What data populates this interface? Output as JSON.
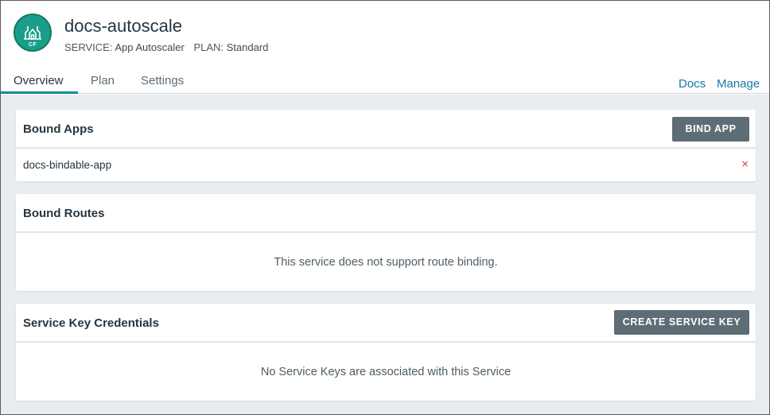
{
  "header": {
    "title": "docs-autoscale",
    "logo_text": "CF",
    "service_label": "SERVICE:",
    "service_value": "App Autoscaler",
    "plan_label": "PLAN:",
    "plan_value": "Standard"
  },
  "tabs": [
    {
      "label": "Overview",
      "active": true
    },
    {
      "label": "Plan",
      "active": false
    },
    {
      "label": "Settings",
      "active": false
    }
  ],
  "links": {
    "docs": "Docs",
    "manage": "Manage"
  },
  "bound_apps": {
    "title": "Bound Apps",
    "button": "BIND APP",
    "items": [
      {
        "name": "docs-bindable-app",
        "remove_icon": "×"
      }
    ]
  },
  "bound_routes": {
    "title": "Bound Routes",
    "message": "This service does not support route binding."
  },
  "service_keys": {
    "title": "Service Key Credentials",
    "button": "CREATE SERVICE KEY",
    "message": "No Service Keys are associated with this Service"
  },
  "colors": {
    "accent": "#1a8a96",
    "link": "#1a77a8",
    "button": "#5e6c75",
    "remove": "#d9383a",
    "logo": "#1a9e8a"
  }
}
